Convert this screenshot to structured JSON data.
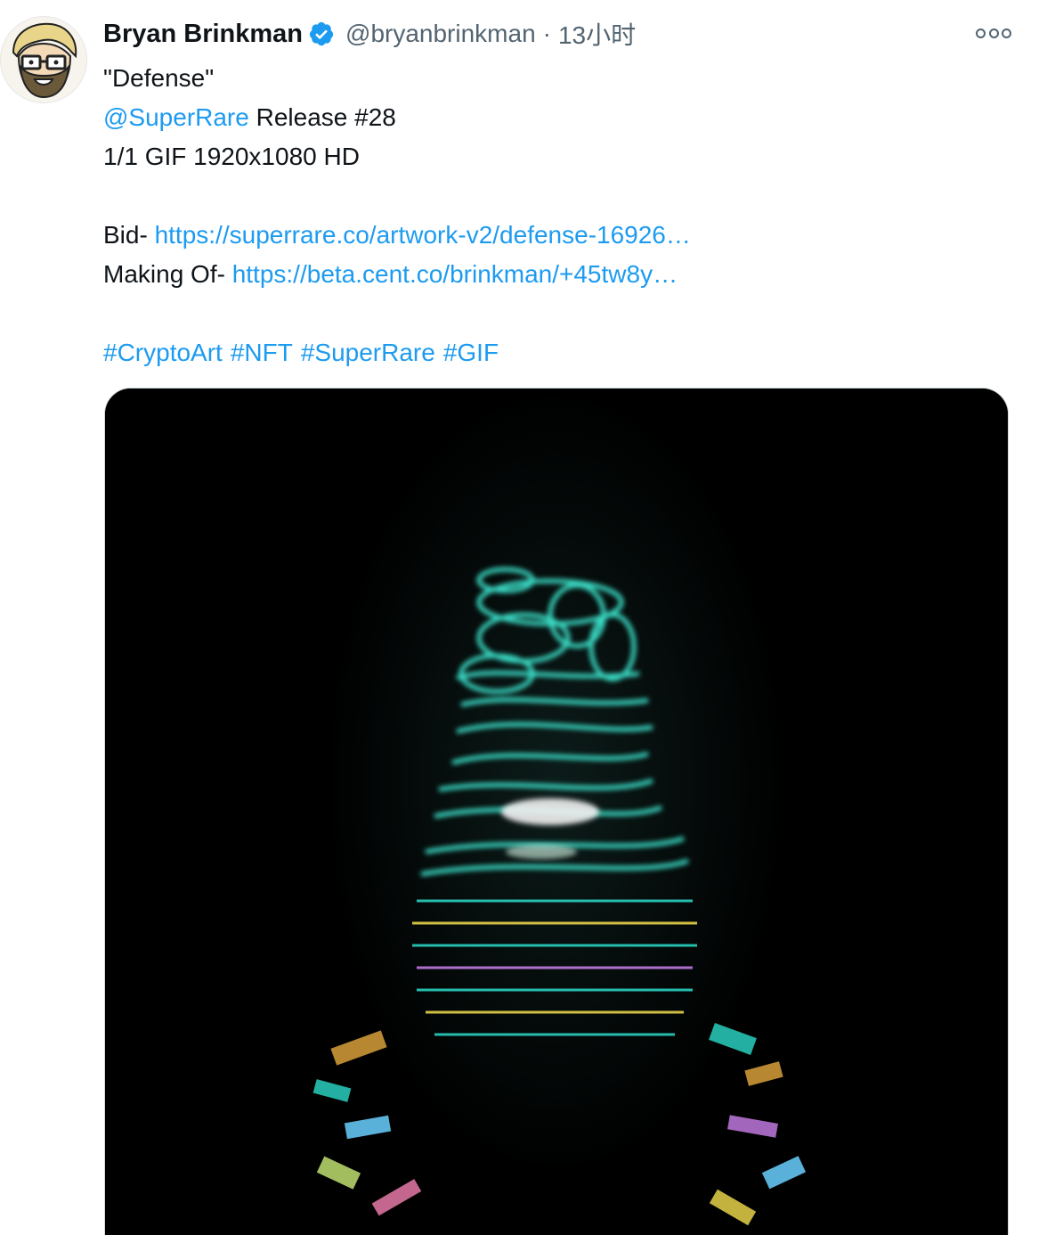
{
  "tweet": {
    "author": {
      "display_name": "Bryan Brinkman",
      "handle": "@bryanbrinkman",
      "verified": true
    },
    "separator": "·",
    "time": "13小时",
    "title_line": "\"Defense\"",
    "mention": "@SuperRare",
    "release_text": " Release #28",
    "spec_line": "1/1 GIF 1920x1080 HD",
    "bid_label": "Bid- ",
    "bid_link": "https://superrare.co/artwork-v2/defense-16926…",
    "making_label": "Making Of- ",
    "making_link": "https://beta.cent.co/brinkman/+45tw8y…",
    "hashtags": [
      "#CryptoArt",
      "#NFT",
      "#SuperRare",
      "#GIF"
    ]
  },
  "icons": {
    "avatar": "cartoon-avatar-icon",
    "verified": "verified-badge-icon",
    "more": "more-options-icon"
  },
  "colors": {
    "link": "#1d9bf0",
    "text": "#0f1419",
    "secondary": "#536471",
    "verified": "#1d9bf0",
    "media_bg": "#000000",
    "glow": "#3ee8d0"
  }
}
